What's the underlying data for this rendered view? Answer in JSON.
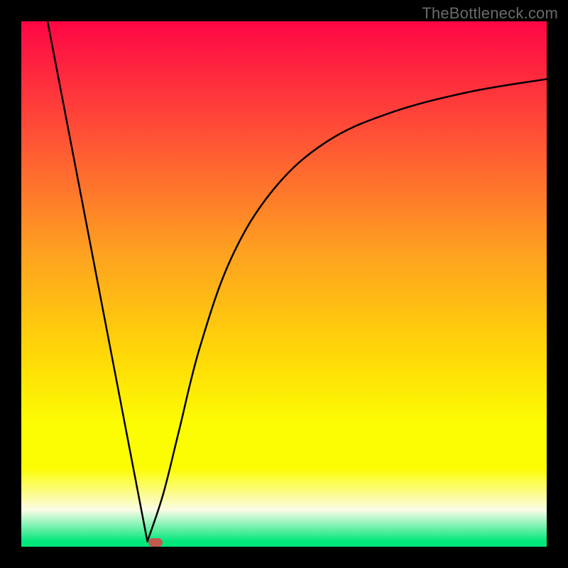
{
  "watermark": "TheBottleneck.com",
  "colors": {
    "frame_border": "#000000",
    "gradient_top": "#fe0645",
    "gradient_mid1": "#ff5236",
    "gradient_mid2": "#fea120",
    "gradient_mid3": "#ffd409",
    "gradient_mid4": "#fcfd02",
    "gradient_pale": "#fbfce6",
    "gradient_bottom": "#01e77b",
    "curve_stroke": "#000000",
    "marker_fill": "#c15a4f"
  },
  "chart_data": {
    "type": "line",
    "title": "",
    "xlabel": "",
    "ylabel": "",
    "x_range": [
      0,
      100
    ],
    "y_range": [
      0,
      100
    ],
    "description": "V-shaped bottleneck curve. Sharp linear descent from top-left, minimum near x≈24, then asymptotic rise to right.",
    "left_segment": {
      "start": {
        "x": 5,
        "y": 100
      },
      "end": {
        "x": 24,
        "y": 1
      }
    },
    "minimum_point": {
      "x": 24,
      "y": 1
    },
    "right_segment_samples": [
      {
        "x": 24,
        "y": 1
      },
      {
        "x": 27,
        "y": 10
      },
      {
        "x": 30,
        "y": 22
      },
      {
        "x": 34,
        "y": 38
      },
      {
        "x": 40,
        "y": 55
      },
      {
        "x": 48,
        "y": 68
      },
      {
        "x": 58,
        "y": 77
      },
      {
        "x": 70,
        "y": 82.5
      },
      {
        "x": 85,
        "y": 86.5
      },
      {
        "x": 100,
        "y": 89
      }
    ],
    "marker": {
      "x": 25.5,
      "y": 0.8
    }
  }
}
